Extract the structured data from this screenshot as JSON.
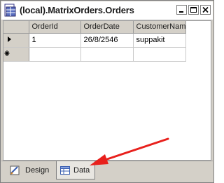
{
  "window": {
    "title": "(local).MatrixOrders.Orders"
  },
  "grid": {
    "columns": [
      "OrderId",
      "OrderDate",
      "CustomerNam"
    ],
    "rows": [
      {
        "indicator": "current",
        "cells": [
          "1",
          "26/8/2546",
          "suppakit"
        ]
      },
      {
        "indicator": "new",
        "cells": [
          "",
          "",
          ""
        ]
      }
    ]
  },
  "tabs": [
    {
      "label": "Design",
      "icon": "design-icon",
      "selected": false
    },
    {
      "label": "Data",
      "icon": "data-grid-icon",
      "selected": true
    }
  ],
  "annotation": {
    "arrow_color": "#e8201c",
    "points_to": "Data"
  }
}
